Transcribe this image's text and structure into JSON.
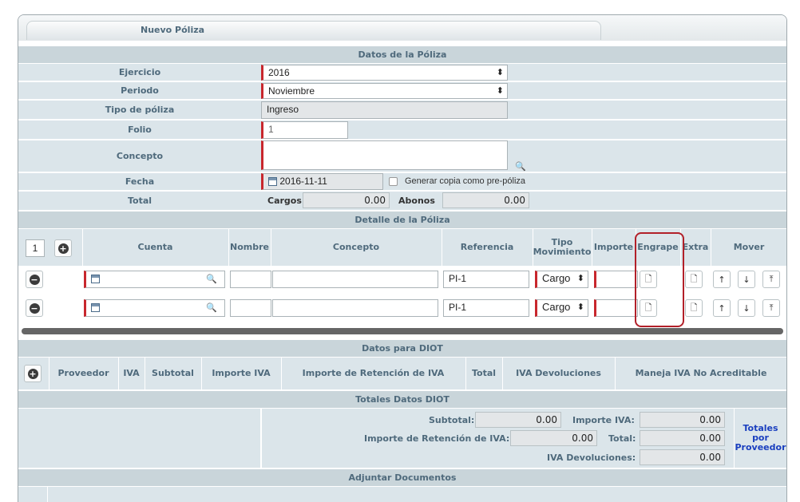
{
  "tab": {
    "title": "Nuevo Póliza"
  },
  "sections": {
    "datos": "Datos de la Póliza",
    "detalle": "Detalle de la Póliza",
    "diot": "Datos para DIOT",
    "totales_diot": "Totales Datos DIOT",
    "adjuntar": "Adjuntar Documentos"
  },
  "form": {
    "ejercicio_label": "Ejercicio",
    "ejercicio_value": "2016",
    "periodo_label": "Periodo",
    "periodo_value": "Noviembre",
    "tipo_label": "Tipo de póliza",
    "tipo_value": "Ingreso",
    "folio_label": "Folio",
    "folio_value": "1",
    "concepto_label": "Concepto",
    "fecha_label": "Fecha",
    "fecha_value": "2016-11-11",
    "copia_label": "Generar copia como pre-póliza",
    "total_label": "Total",
    "cargos_label": "Cargos",
    "cargos_value": "0.00",
    "abonos_label": "Abonos",
    "abonos_value": "0.00"
  },
  "detalle": {
    "count": "1",
    "columns": {
      "cuenta": "Cuenta",
      "nombre": "Nombre",
      "concepto": "Concepto",
      "referencia": "Referencia",
      "tipo_mov": "Tipo Movimiento",
      "importe": "Importe",
      "engrape": "Engrape",
      "extra": "Extra",
      "mover": "Mover"
    },
    "rows": [
      {
        "referencia": "PI-1",
        "tipo": "Cargo"
      },
      {
        "referencia": "PI-1",
        "tipo": "Cargo"
      }
    ]
  },
  "diot": {
    "columns": {
      "proveedor": "Proveedor",
      "iva": "IVA",
      "subtotal": "Subtotal",
      "importe_iva": "Importe IVA",
      "retencion": "Importe de Retención de IVA",
      "total": "Total",
      "devoluciones": "IVA Devoluciones",
      "no_acreditable": "Maneja IVA No Acreditable"
    }
  },
  "totales": {
    "subtotal_label": "Subtotal:",
    "subtotal_value": "0.00",
    "importe_iva_label": "Importe IVA:",
    "importe_iva_value": "0.00",
    "retencion_label": "Importe de Retención de IVA:",
    "retencion_value": "0.00",
    "total_label": "Total:",
    "total_value": "0.00",
    "devoluciones_label": "IVA Devoluciones:",
    "devoluciones_value": "0.00",
    "por_proveedor_link": "Totales por Proveedor"
  },
  "colors": {
    "required": "#c8272d",
    "header_bg": "#c9d5da",
    "label_bg": "#dbe5ea",
    "highlight": "#b22029"
  }
}
